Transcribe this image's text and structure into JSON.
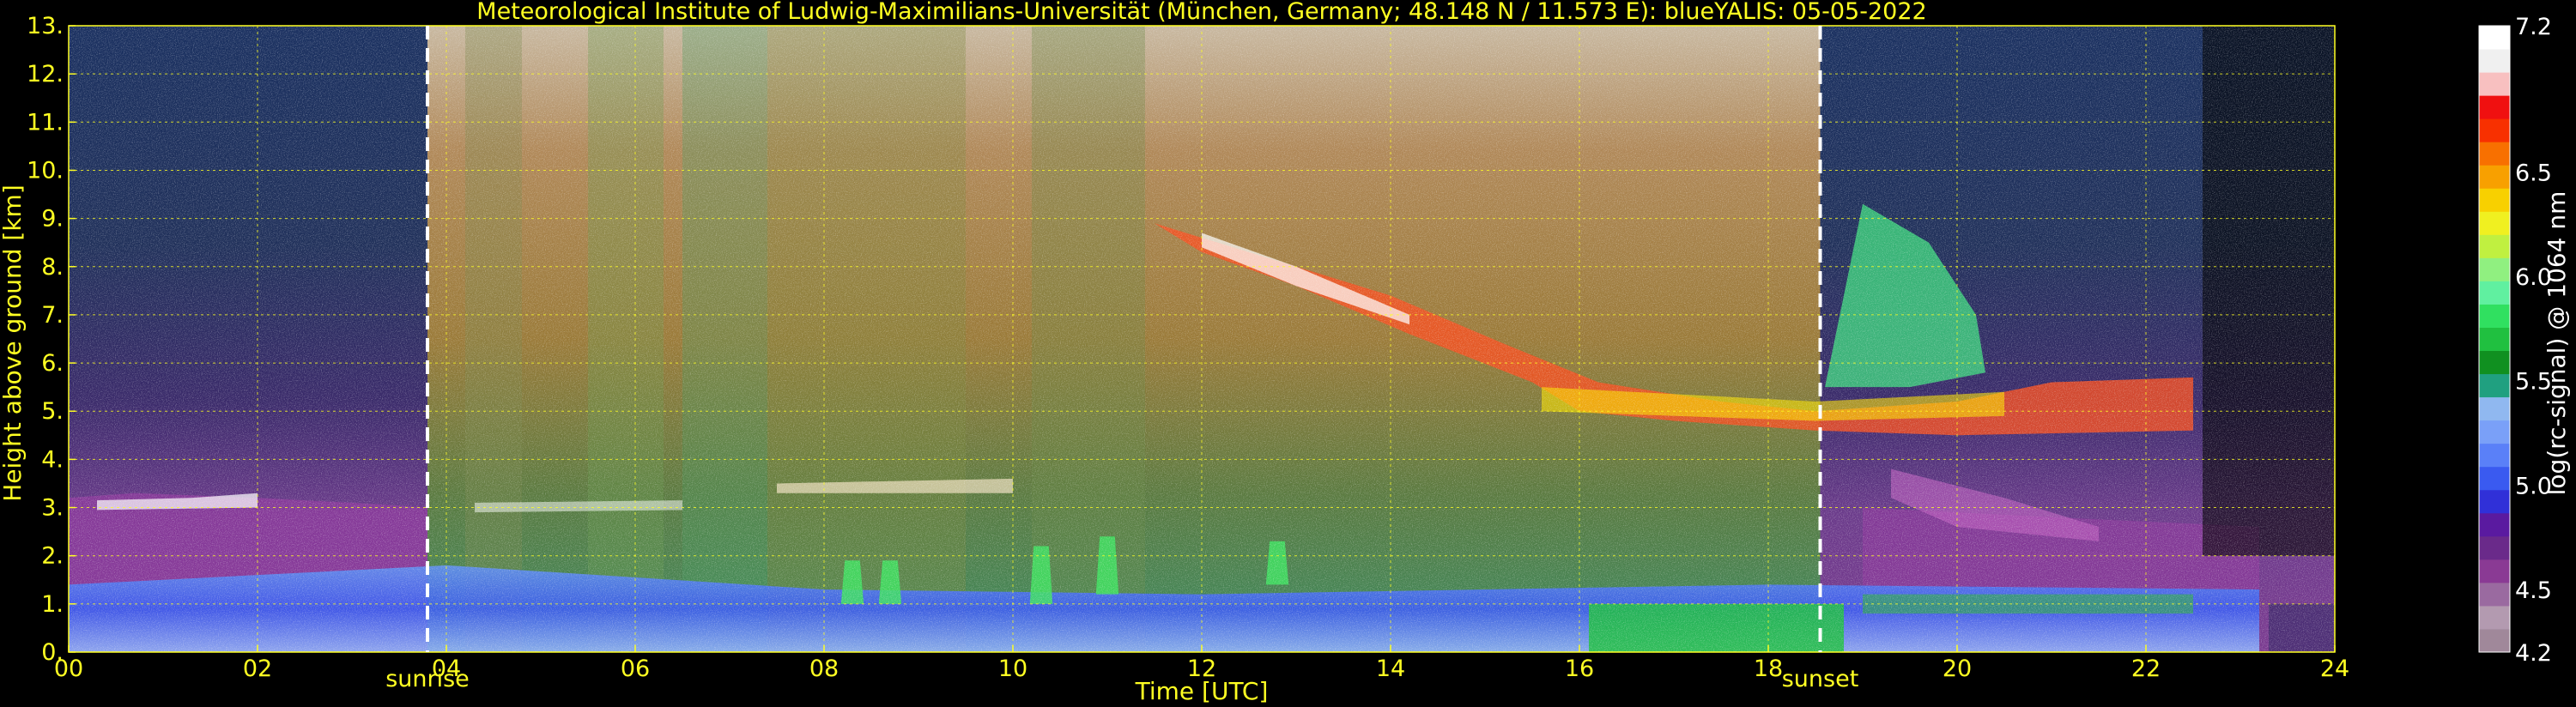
{
  "chart_data": {
    "type": "heatmap",
    "title": "Meteorological Institute of Ludwig-Maximilians-Universität (München, Germany; 48.148 N / 11.573 E):    blueYALIS: 05-05-2022",
    "xlabel": "Time [UTC]",
    "ylabel": "Height above ground [km]",
    "xlim": [
      0,
      24
    ],
    "ylim": [
      0,
      13
    ],
    "x_ticks": [
      {
        "value": 0,
        "label": "00"
      },
      {
        "value": 2,
        "label": "02"
      },
      {
        "value": 4,
        "label": "04"
      },
      {
        "value": 6,
        "label": "06"
      },
      {
        "value": 8,
        "label": "08"
      },
      {
        "value": 10,
        "label": "10"
      },
      {
        "value": 12,
        "label": "12"
      },
      {
        "value": 14,
        "label": "14"
      },
      {
        "value": 16,
        "label": "16"
      },
      {
        "value": 18,
        "label": "18"
      },
      {
        "value": 20,
        "label": "20"
      },
      {
        "value": 22,
        "label": "22"
      },
      {
        "value": 24,
        "label": "24"
      }
    ],
    "y_ticks": [
      {
        "value": 0,
        "label": "0."
      },
      {
        "value": 1,
        "label": "1."
      },
      {
        "value": 2,
        "label": "2."
      },
      {
        "value": 3,
        "label": "3."
      },
      {
        "value": 4,
        "label": "4."
      },
      {
        "value": 5,
        "label": "5."
      },
      {
        "value": 6,
        "label": "6."
      },
      {
        "value": 7,
        "label": "7."
      },
      {
        "value": 8,
        "label": "8."
      },
      {
        "value": 9,
        "label": "9."
      },
      {
        "value": 10,
        "label": "10."
      },
      {
        "value": 11,
        "label": "11."
      },
      {
        "value": 12,
        "label": "12."
      },
      {
        "value": 13,
        "label": "13."
      }
    ],
    "grid": true,
    "markers": [
      {
        "x": 3.8,
        "label": "sunrise"
      },
      {
        "x": 18.55,
        "label": "sunset"
      }
    ],
    "colorbar": {
      "label": "log(rc-signal) @ 1064 nm",
      "range": [
        4.2,
        7.2
      ],
      "ticks": [
        {
          "value": 4.2,
          "label": "4.2"
        },
        {
          "value": 4.5,
          "label": "4.5"
        },
        {
          "value": 5.0,
          "label": "5.0"
        },
        {
          "value": 5.5,
          "label": "5.5"
        },
        {
          "value": 6.0,
          "label": "6.0"
        },
        {
          "value": 6.5,
          "label": "6.5"
        },
        {
          "value": 7.2,
          "label": "7.2"
        }
      ],
      "colors": [
        "#a0889a",
        "#b39ab0",
        "#9a6aa0",
        "#8a3a94",
        "#6a2a8a",
        "#5a1aa0",
        "#3030d8",
        "#3a5af0",
        "#5a80f8",
        "#7aa0f8",
        "#90b8f0",
        "#20a080",
        "#109020",
        "#20c040",
        "#30e060",
        "#60f0a0",
        "#90f080",
        "#c0f040",
        "#f0f020",
        "#f8d000",
        "#f8a000",
        "#f87000",
        "#f83000",
        "#f01010",
        "#f8c0c0",
        "#f0f0f0",
        "#ffffff"
      ]
    },
    "layers": [
      {
        "desc": "boundary-layer aerosol blue",
        "x": [
          0,
          23.2
        ],
        "y": [
          0,
          1.3
        ],
        "color": "#3a6cf0"
      },
      {
        "desc": "residual layer magenta",
        "x": [
          0,
          3.8
        ],
        "y": [
          1.0,
          3.3
        ],
        "color": "#8a3a9a"
      },
      {
        "desc": "ci-cloud",
        "x": [
          11.5,
          22.5
        ],
        "y": [
          4.5,
          9.0
        ],
        "color": "#f83020"
      }
    ],
    "noise": {
      "day": [
        3.8,
        18.55
      ],
      "day_color": "#c09a40",
      "night_color": "#5a2a8a"
    }
  }
}
